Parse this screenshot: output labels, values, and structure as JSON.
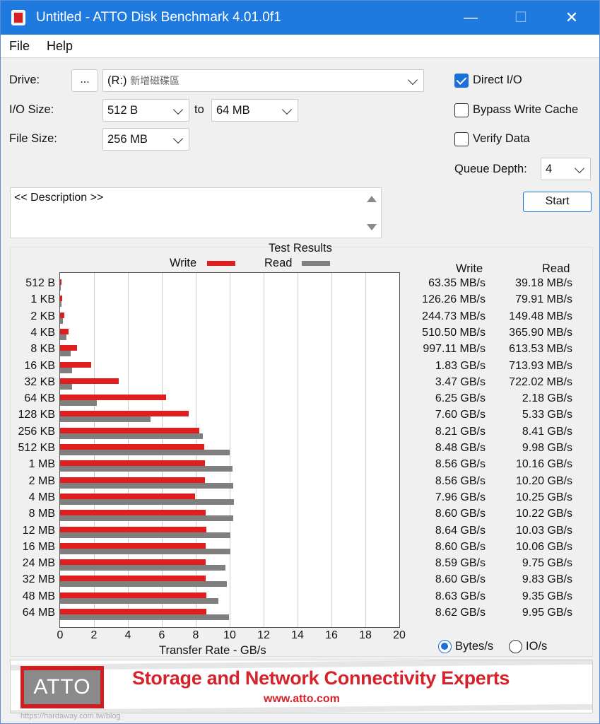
{
  "window": {
    "title": "Untitled - ATTO Disk Benchmark 4.01.0f1",
    "min_glyph": "—",
    "max_glyph": "☐",
    "close_glyph": "✕",
    "titlebar_color": "#1f7ae0"
  },
  "menu": {
    "file": "File",
    "help": "Help"
  },
  "drive": {
    "label": "Drive:",
    "browse_label": "...",
    "value_prefix": "(R:)",
    "value_name": "新增磁碟區"
  },
  "io_size": {
    "label": "I/O Size:",
    "from": "512 B",
    "to_label": "to",
    "to": "64 MB"
  },
  "file_size": {
    "label": "File Size:",
    "value": "256 MB"
  },
  "options": {
    "direct_io": {
      "label": "Direct I/O",
      "checked": true
    },
    "bypass_write_cache": {
      "label": "Bypass Write Cache",
      "checked": false
    },
    "verify_data": {
      "label": "Verify Data",
      "checked": false
    },
    "queue_depth_label": "Queue Depth:",
    "queue_depth": "4"
  },
  "start_label": "Start",
  "description": "<< Description >>",
  "results": {
    "title": "Test Results",
    "write_legend": "Write",
    "read_legend": "Read",
    "write_header": "Write",
    "read_header": "Read",
    "x_axis_label": "Transfer Rate - GB/s",
    "x_ticks": [
      "0",
      "2",
      "4",
      "6",
      "8",
      "10",
      "12",
      "14",
      "16",
      "18",
      "20"
    ],
    "write_color": "#e01e1e",
    "read_color": "#7f7f7f"
  },
  "units": {
    "bytes_label": "Bytes/s",
    "io_label": "IO/s",
    "selected": "bytes"
  },
  "banner": {
    "logo": "ATTO",
    "tagline": "Storage and Network Connectivity Experts",
    "website": "www.atto.com",
    "accent": "#d6232b"
  },
  "watermark": "https://hardaway.com.tw/blog",
  "chart_data": {
    "type": "bar",
    "orientation": "horizontal",
    "xlabel": "Transfer Rate - GB/s",
    "xlim": [
      0,
      20
    ],
    "categories": [
      "512 B",
      "1 KB",
      "2 KB",
      "4 KB",
      "8 KB",
      "16 KB",
      "32 KB",
      "64 KB",
      "128 KB",
      "256 KB",
      "512 KB",
      "1 MB",
      "2 MB",
      "4 MB",
      "8 MB",
      "12 MB",
      "16 MB",
      "24 MB",
      "32 MB",
      "48 MB",
      "64 MB"
    ],
    "series": [
      {
        "name": "Write",
        "values": [
          0.0634,
          0.1263,
          0.2447,
          0.5105,
          0.9971,
          1.83,
          3.47,
          6.25,
          7.6,
          8.21,
          8.48,
          8.56,
          8.56,
          7.96,
          8.6,
          8.64,
          8.6,
          8.59,
          8.6,
          8.63,
          8.62
        ],
        "labels": [
          "63.35 MB/s",
          "126.26 MB/s",
          "244.73 MB/s",
          "510.50 MB/s",
          "997.11 MB/s",
          "1.83 GB/s",
          "3.47 GB/s",
          "6.25 GB/s",
          "7.60 GB/s",
          "8.21 GB/s",
          "8.48 GB/s",
          "8.56 GB/s",
          "8.56 GB/s",
          "7.96 GB/s",
          "8.60 GB/s",
          "8.64 GB/s",
          "8.60 GB/s",
          "8.59 GB/s",
          "8.60 GB/s",
          "8.63 GB/s",
          "8.62 GB/s"
        ]
      },
      {
        "name": "Read",
        "values": [
          0.0392,
          0.0799,
          0.1495,
          0.3659,
          0.6135,
          0.7139,
          0.722,
          2.18,
          5.33,
          8.41,
          9.98,
          10.16,
          10.2,
          10.25,
          10.22,
          10.03,
          10.06,
          9.75,
          9.83,
          9.35,
          9.95
        ],
        "labels": [
          "39.18 MB/s",
          "79.91 MB/s",
          "149.48 MB/s",
          "365.90 MB/s",
          "613.53 MB/s",
          "713.93 MB/s",
          "722.02 MB/s",
          "2.18 GB/s",
          "5.33 GB/s",
          "8.41 GB/s",
          "9.98 GB/s",
          "10.16 GB/s",
          "10.20 GB/s",
          "10.25 GB/s",
          "10.22 GB/s",
          "10.03 GB/s",
          "10.06 GB/s",
          "9.75 GB/s",
          "9.83 GB/s",
          "9.35 GB/s",
          "9.95 GB/s"
        ]
      }
    ]
  }
}
